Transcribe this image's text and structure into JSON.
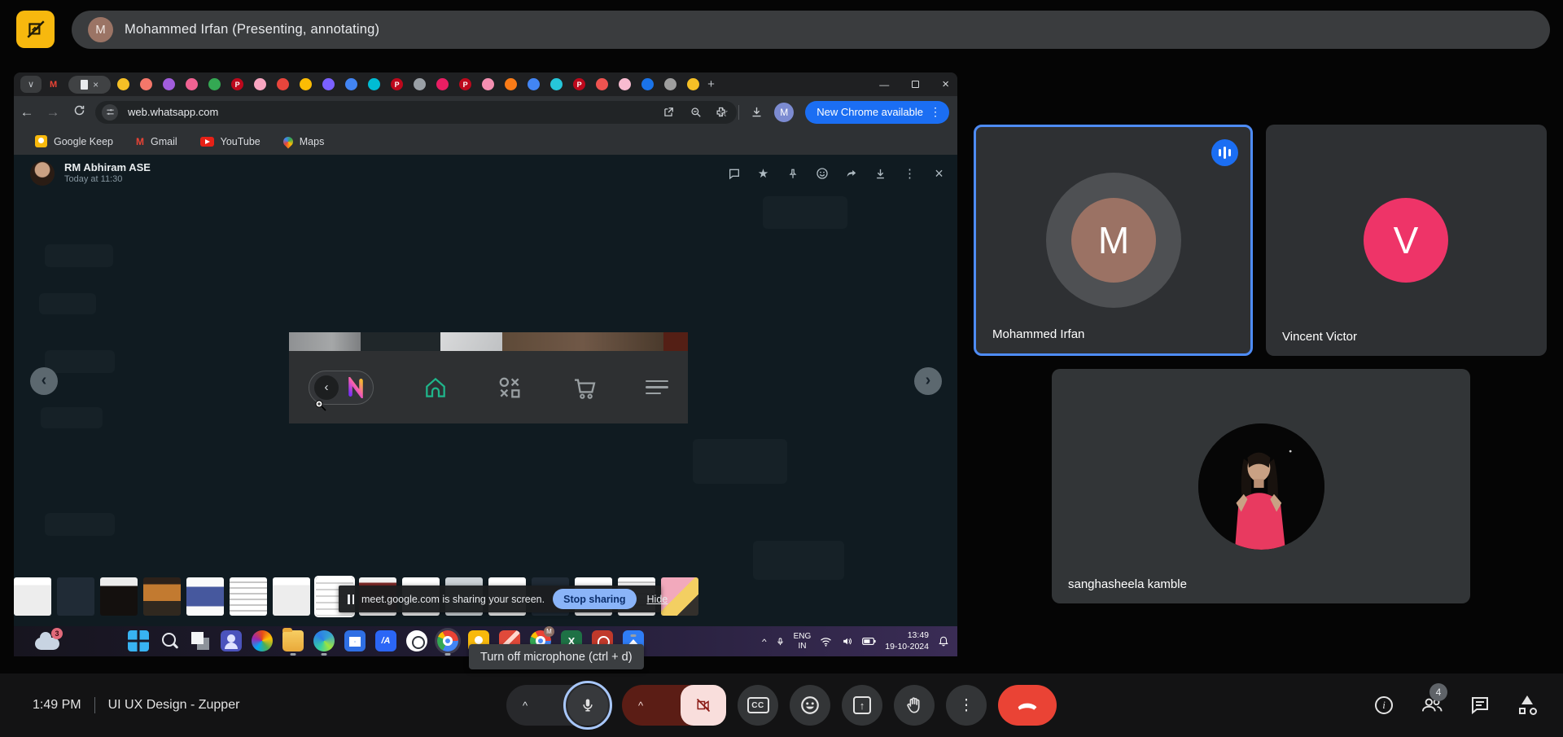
{
  "banner": {
    "initial": "M",
    "text": "Mohammed Irfan (Presenting, annotating)"
  },
  "chrome": {
    "url": "web.whatsapp.com",
    "update_button": "New Chrome available",
    "bookmarks": [
      "Google Keep",
      "Gmail",
      "YouTube",
      "Maps"
    ],
    "favicons": [
      "#f6c026",
      "#f4776a",
      "#a25ddc",
      "#f06292",
      "#34a853",
      "#bd081c|P",
      "#f8a5c0",
      "#e8453c",
      "#fbbc04",
      "#7b61ff",
      "#4285f4",
      "#00bcd4",
      "#bd081c|P",
      "#9aa0a6",
      "#e91e63",
      "#bd081c|P",
      "#f48fb1",
      "#fa7b17",
      "#4285f4",
      "#26c6da",
      "#bd081c|P",
      "#ef5350",
      "#f8bbd0",
      "#1a73e8",
      "#9e9e9e",
      "#f6c026"
    ]
  },
  "whatsapp": {
    "contact": "RM Abhiram ASE",
    "timestamp": "Today at 11:30"
  },
  "share_notice": {
    "message": "meet.google.com is sharing your screen.",
    "stop_label": "Stop sharing",
    "hide_label": "Hide"
  },
  "thumbnails": [
    "doc",
    "dark",
    "phone",
    "orange",
    "blue",
    "text",
    "doc",
    "sel",
    "red",
    "doc",
    "gray",
    "doc",
    "dark",
    "doc",
    "text",
    "color"
  ],
  "taskbar": {
    "badge": "3",
    "icons": [
      "win",
      "search",
      "task",
      "teams",
      "office",
      "folder",
      "edge",
      "store",
      "ai",
      "wa",
      "chrome",
      "keep",
      "red",
      "chrome2",
      "excel",
      "pdf",
      "photos"
    ],
    "running": [
      "folder",
      "edge",
      "chrome",
      "photos"
    ],
    "lang_line1": "ENG",
    "lang_line2": "IN",
    "clock_time": "13:49",
    "clock_date": "19-10-2024"
  },
  "meet_bar": {
    "clock": "1:49 PM",
    "title": "UI UX Design - Zupper",
    "mic_tooltip": "Turn off microphone (ctrl + d)",
    "participants_count": "4",
    "cc_label": "CC"
  },
  "participants": [
    {
      "name": "Mohammed Irfan",
      "initial": "M",
      "speaking": true
    },
    {
      "name": "Vincent Victor",
      "initial": "V",
      "speaking": false
    },
    {
      "name": "sanghasheela kamble",
      "speaking": false
    }
  ],
  "colors": {
    "annotation_bg": "#f7b80e",
    "tile_border": "#4e8cf7",
    "speaking_indicator": "#1b6ef3",
    "avatar_mohammed": "#9b7264",
    "avatar_vincent": "#ee3468",
    "end_call": "#ea4335",
    "stop_share_bg": "#8ab4f8",
    "update_pill": "#1b6ef3",
    "home_icon_teal": "#1fb68b"
  }
}
